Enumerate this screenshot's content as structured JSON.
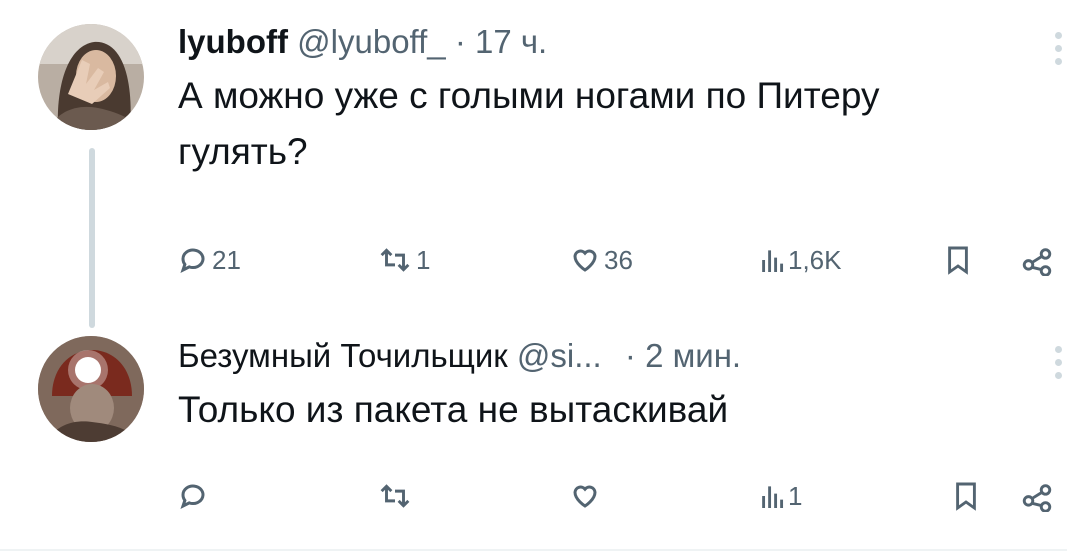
{
  "tweets": [
    {
      "author_name": "lyuboff",
      "handle": "@lyuboff_",
      "time": "· 17 ч.",
      "text": "А можно уже с голыми ногами по Питеру гулять?",
      "replies": "21",
      "retweets": "1",
      "likes": "36",
      "views": "1,6K"
    },
    {
      "author_name": "Безумный Точильщик",
      "handle": "@si...",
      "time": "· 2 мин.",
      "text": "Только из пакета не вытаскивай",
      "replies": "",
      "retweets": "",
      "likes": "",
      "views": "1"
    }
  ],
  "colors": {
    "text": "#0f1419",
    "muted": "#536471",
    "thread_line": "#cfd9de"
  },
  "icons": [
    "reply-icon",
    "retweet-icon",
    "like-icon",
    "views-icon",
    "bookmark-icon",
    "share-icon",
    "more-icon"
  ]
}
